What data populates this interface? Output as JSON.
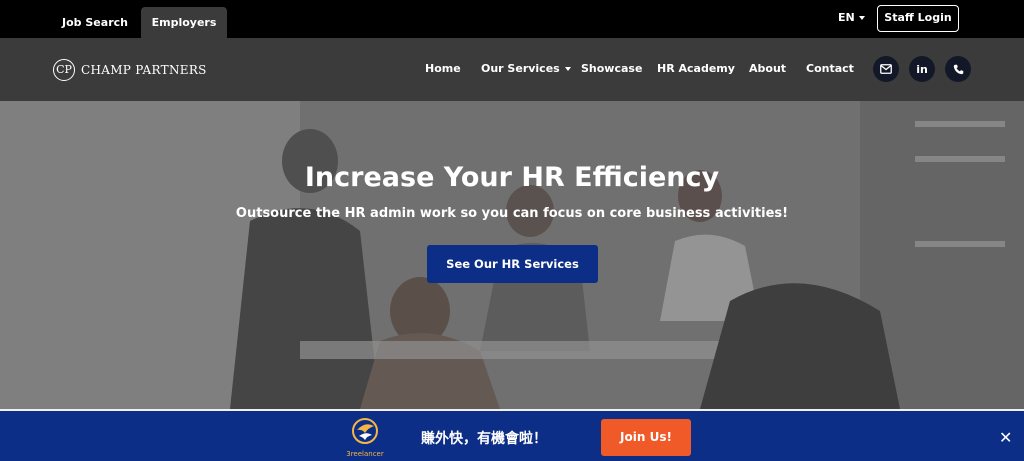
{
  "topbar": {
    "tabs": [
      {
        "label": "Job Search"
      },
      {
        "label": "Employers"
      }
    ],
    "language": "EN",
    "staff_login": "Staff Login"
  },
  "navbar": {
    "logo_text": "CHAMP PARTNERS",
    "logo_mark": "CP",
    "items": [
      {
        "label": "Home"
      },
      {
        "label": "Our Services"
      },
      {
        "label": "Showcase"
      },
      {
        "label": "HR Academy"
      },
      {
        "label": "About"
      },
      {
        "label": "Contact"
      }
    ],
    "icons": [
      "mail-icon",
      "linkedin-icon",
      "phone-icon"
    ],
    "linkedin_glyph": "in"
  },
  "hero": {
    "title": "Increase Your HR Efficiency",
    "subtitle": "Outsource the HR admin work so you can focus on core business activities!",
    "cta": "See Our HR Services"
  },
  "banner": {
    "logo_text": "3reelancer",
    "text": "賺外快，有機會啦！",
    "cta": "Join Us!",
    "close": "✕"
  },
  "colors": {
    "topbar_bg": "#000000",
    "navbar_bg": "#3b3b3b",
    "primary_blue": "#0d2e86",
    "join_orange": "#ef5a28",
    "icon_circle": "#121827"
  }
}
